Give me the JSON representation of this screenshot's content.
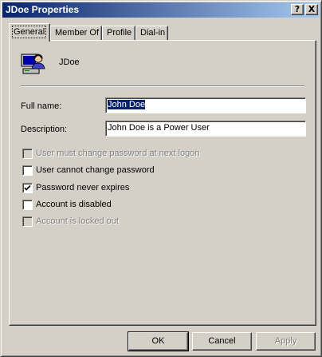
{
  "window": {
    "title": "JDoe Properties"
  },
  "title_buttons": {
    "help": "?",
    "close": "X"
  },
  "tabs": [
    {
      "label": "General",
      "active": true
    },
    {
      "label": "Member Of",
      "active": false
    },
    {
      "label": "Profile",
      "active": false
    },
    {
      "label": "Dial-in",
      "active": false
    }
  ],
  "general": {
    "icon": "user-computer-icon",
    "username": "JDoe",
    "full_name_label": "Full name:",
    "full_name_value": "John Doe",
    "description_label": "Description:",
    "description_value": "John Doe is a Power User",
    "checkboxes": [
      {
        "label": "User must change password at next logon",
        "checked": false,
        "enabled": false
      },
      {
        "label": "User cannot change password",
        "checked": false,
        "enabled": true
      },
      {
        "label": "Password never expires",
        "checked": true,
        "enabled": true
      },
      {
        "label": "Account is disabled",
        "checked": false,
        "enabled": true
      },
      {
        "label": "Account is locked out",
        "checked": false,
        "enabled": false
      }
    ]
  },
  "buttons": {
    "ok": "OK",
    "cancel": "Cancel",
    "apply": "Apply"
  },
  "colors": {
    "face": "#d4d0c8",
    "title_start": "#0a246a",
    "title_end": "#a6caf0",
    "selection": "#0a246a"
  }
}
